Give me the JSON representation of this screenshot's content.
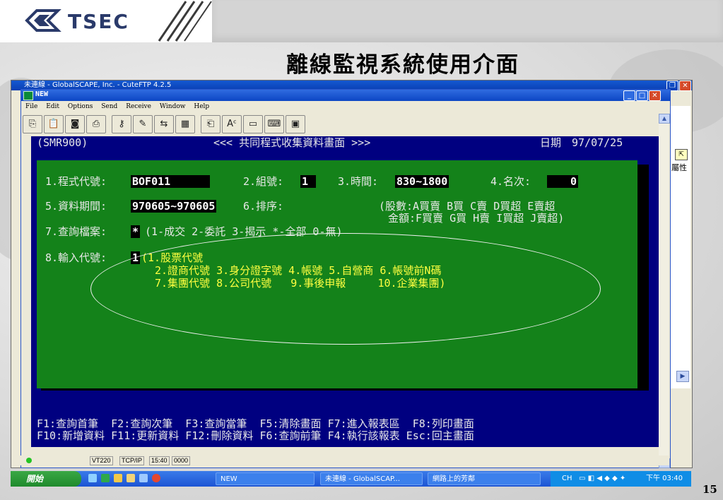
{
  "slide": {
    "brand": "TSEC",
    "title": "離線監視系統使用介面",
    "page_number": "15"
  },
  "back_window": {
    "title": "未連線 - GlobalSCAPE, Inc. - CuteFTP 4.2.5",
    "properties_label": "屬性"
  },
  "window": {
    "title": "NEW",
    "menu": [
      "File",
      "Edit",
      "Options",
      "Send",
      "Receive",
      "Window",
      "Help"
    ],
    "toolbar_icons": [
      "copy-icon",
      "paste-icon",
      "camera-icon",
      "print-icon",
      "key-icon",
      "pen-icon",
      "transfer-icon",
      "grid-icon",
      "capture-icon",
      "spell-icon",
      "printer2-icon",
      "keyboard-icon",
      "image-icon"
    ]
  },
  "terminal": {
    "program_id": "(SMR900)",
    "screen_title": "<<< 共同程式收集資料畫面 >>>",
    "date_label": "日期",
    "date_value": "97/07/25",
    "f1_label": "1.程式代號:",
    "f1_value": "BOF011",
    "f2_label": "2.組號:",
    "f2_value": "1",
    "f3_label": "3.時間:",
    "f3_value": "830~1800",
    "f4_label": "4.名次:",
    "f4_value": "0",
    "f5_label": "5.資料期間:",
    "f5_value": "970605~970605",
    "f6_label": "6.排序:",
    "f6_value": "",
    "f6_hint1": "(股數:A買賣 B買 C賣 D買超 E賣超",
    "f6_hint2": "金額:F買賣 G買 H賣 I買超 J賣超)",
    "f7_label": "7.查詢檔案:",
    "f7_value": "*",
    "f7_hint": " (1-成交 2-委託 3-揭示 *-全部 0-無)",
    "f8_label": "8.輸入代號:",
    "f8_value": "1",
    "f8_opt1": "(1.股票代號",
    "f8_row2": "2.證商代號 3.身分證字號 4.帳號 5.自營商 6.帳號前N碼",
    "f8_row3": "7.集團代號 8.公司代號   9.事後申報     10.企業集團)",
    "fkeys1": "F1:查詢首筆  F2:查詢次筆  F3:查詢當筆  F5:清除畫面 F7:進入報表區  F8:列印畫面",
    "fkeys2": "F10:新增資料 F11:更新資料 F12:刪除資料 F6:查詢前筆 F4:執行該報表 Esc:回主畫面"
  },
  "status_bar": {
    "terminal_type": "VT220",
    "protocol": "TCP/IP",
    "time": "15:40",
    "indicators": "0000"
  },
  "taskbar": {
    "start_label": "開始",
    "items": [
      "NEW",
      "未連線 - GlobalSCAP...",
      "網路上的芳鄰"
    ],
    "lang": "CH",
    "clock": "下午 03:40"
  }
}
